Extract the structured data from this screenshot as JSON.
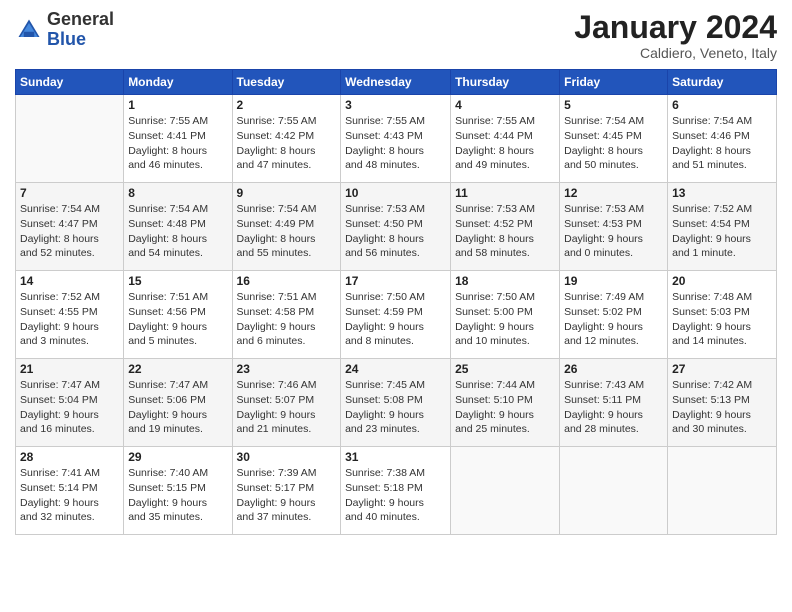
{
  "header": {
    "logo": {
      "line1": "General",
      "line2": "Blue"
    },
    "title": "January 2024",
    "subtitle": "Caldiero, Veneto, Italy"
  },
  "weekdays": [
    "Sunday",
    "Monday",
    "Tuesday",
    "Wednesday",
    "Thursday",
    "Friday",
    "Saturday"
  ],
  "weeks": [
    [
      {
        "day": "",
        "info": ""
      },
      {
        "day": "1",
        "info": "Sunrise: 7:55 AM\nSunset: 4:41 PM\nDaylight: 8 hours\nand 46 minutes."
      },
      {
        "day": "2",
        "info": "Sunrise: 7:55 AM\nSunset: 4:42 PM\nDaylight: 8 hours\nand 47 minutes."
      },
      {
        "day": "3",
        "info": "Sunrise: 7:55 AM\nSunset: 4:43 PM\nDaylight: 8 hours\nand 48 minutes."
      },
      {
        "day": "4",
        "info": "Sunrise: 7:55 AM\nSunset: 4:44 PM\nDaylight: 8 hours\nand 49 minutes."
      },
      {
        "day": "5",
        "info": "Sunrise: 7:54 AM\nSunset: 4:45 PM\nDaylight: 8 hours\nand 50 minutes."
      },
      {
        "day": "6",
        "info": "Sunrise: 7:54 AM\nSunset: 4:46 PM\nDaylight: 8 hours\nand 51 minutes."
      }
    ],
    [
      {
        "day": "7",
        "info": "Sunrise: 7:54 AM\nSunset: 4:47 PM\nDaylight: 8 hours\nand 52 minutes."
      },
      {
        "day": "8",
        "info": "Sunrise: 7:54 AM\nSunset: 4:48 PM\nDaylight: 8 hours\nand 54 minutes."
      },
      {
        "day": "9",
        "info": "Sunrise: 7:54 AM\nSunset: 4:49 PM\nDaylight: 8 hours\nand 55 minutes."
      },
      {
        "day": "10",
        "info": "Sunrise: 7:53 AM\nSunset: 4:50 PM\nDaylight: 8 hours\nand 56 minutes."
      },
      {
        "day": "11",
        "info": "Sunrise: 7:53 AM\nSunset: 4:52 PM\nDaylight: 8 hours\nand 58 minutes."
      },
      {
        "day": "12",
        "info": "Sunrise: 7:53 AM\nSunset: 4:53 PM\nDaylight: 9 hours\nand 0 minutes."
      },
      {
        "day": "13",
        "info": "Sunrise: 7:52 AM\nSunset: 4:54 PM\nDaylight: 9 hours\nand 1 minute."
      }
    ],
    [
      {
        "day": "14",
        "info": "Sunrise: 7:52 AM\nSunset: 4:55 PM\nDaylight: 9 hours\nand 3 minutes."
      },
      {
        "day": "15",
        "info": "Sunrise: 7:51 AM\nSunset: 4:56 PM\nDaylight: 9 hours\nand 5 minutes."
      },
      {
        "day": "16",
        "info": "Sunrise: 7:51 AM\nSunset: 4:58 PM\nDaylight: 9 hours\nand 6 minutes."
      },
      {
        "day": "17",
        "info": "Sunrise: 7:50 AM\nSunset: 4:59 PM\nDaylight: 9 hours\nand 8 minutes."
      },
      {
        "day": "18",
        "info": "Sunrise: 7:50 AM\nSunset: 5:00 PM\nDaylight: 9 hours\nand 10 minutes."
      },
      {
        "day": "19",
        "info": "Sunrise: 7:49 AM\nSunset: 5:02 PM\nDaylight: 9 hours\nand 12 minutes."
      },
      {
        "day": "20",
        "info": "Sunrise: 7:48 AM\nSunset: 5:03 PM\nDaylight: 9 hours\nand 14 minutes."
      }
    ],
    [
      {
        "day": "21",
        "info": "Sunrise: 7:47 AM\nSunset: 5:04 PM\nDaylight: 9 hours\nand 16 minutes."
      },
      {
        "day": "22",
        "info": "Sunrise: 7:47 AM\nSunset: 5:06 PM\nDaylight: 9 hours\nand 19 minutes."
      },
      {
        "day": "23",
        "info": "Sunrise: 7:46 AM\nSunset: 5:07 PM\nDaylight: 9 hours\nand 21 minutes."
      },
      {
        "day": "24",
        "info": "Sunrise: 7:45 AM\nSunset: 5:08 PM\nDaylight: 9 hours\nand 23 minutes."
      },
      {
        "day": "25",
        "info": "Sunrise: 7:44 AM\nSunset: 5:10 PM\nDaylight: 9 hours\nand 25 minutes."
      },
      {
        "day": "26",
        "info": "Sunrise: 7:43 AM\nSunset: 5:11 PM\nDaylight: 9 hours\nand 28 minutes."
      },
      {
        "day": "27",
        "info": "Sunrise: 7:42 AM\nSunset: 5:13 PM\nDaylight: 9 hours\nand 30 minutes."
      }
    ],
    [
      {
        "day": "28",
        "info": "Sunrise: 7:41 AM\nSunset: 5:14 PM\nDaylight: 9 hours\nand 32 minutes."
      },
      {
        "day": "29",
        "info": "Sunrise: 7:40 AM\nSunset: 5:15 PM\nDaylight: 9 hours\nand 35 minutes."
      },
      {
        "day": "30",
        "info": "Sunrise: 7:39 AM\nSunset: 5:17 PM\nDaylight: 9 hours\nand 37 minutes."
      },
      {
        "day": "31",
        "info": "Sunrise: 7:38 AM\nSunset: 5:18 PM\nDaylight: 9 hours\nand 40 minutes."
      },
      {
        "day": "",
        "info": ""
      },
      {
        "day": "",
        "info": ""
      },
      {
        "day": "",
        "info": ""
      }
    ]
  ]
}
